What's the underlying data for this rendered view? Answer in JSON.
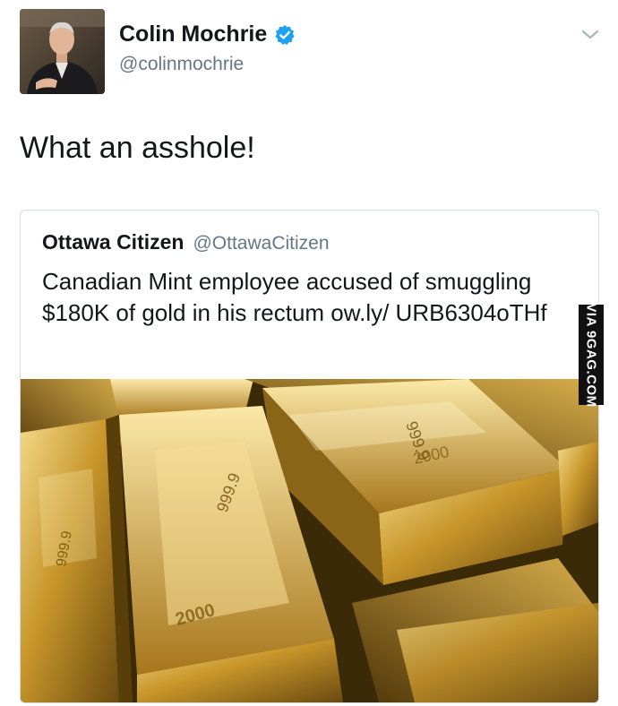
{
  "tweet": {
    "author_name": "Colin Mochrie",
    "author_handle": "@colinmochrie",
    "verified": true,
    "text": "What an asshole!",
    "menu_icon": "chevron-down-icon"
  },
  "quoted_tweet": {
    "author_name": "Ottawa Citizen",
    "author_handle": "@OttawaCitizen",
    "text": "Canadian Mint employee accused of smuggling $180K of gold in his rectum ow.ly/ URB6304oTHf",
    "image_alt": "Stacked gold bars"
  },
  "watermark": "VIA 9GAG.COM",
  "colors": {
    "verified_blue": "#1da1f2",
    "handle_gray": "#657786",
    "border": "#d7dce0"
  }
}
